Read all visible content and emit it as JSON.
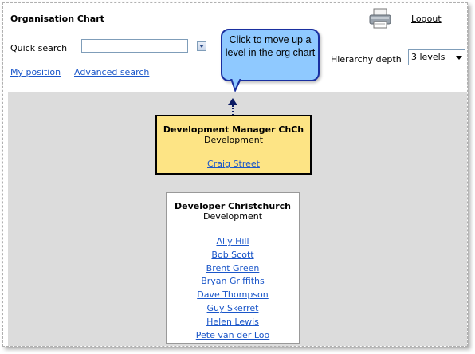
{
  "header": {
    "title": "Organisation Chart",
    "logout_label": "Logout",
    "print_icon": "printer-icon"
  },
  "search": {
    "quick_search_label": "Quick search",
    "quick_search_value": "",
    "my_position_label": "My position",
    "advanced_search_label": "Advanced search"
  },
  "hierarchy": {
    "label": "Hierarchy depth",
    "selected": "3 levels"
  },
  "callout": {
    "text": "Click to move up a level in the org chart"
  },
  "colors": {
    "manager_fill": "#fde485",
    "chart_background": "#dcdcdc",
    "callout_fill": "#8fc9ff",
    "link": "#1a56c9"
  },
  "org": {
    "manager": {
      "title": "Development Manager ChCh",
      "department": "Development",
      "people": [
        "Craig Street"
      ]
    },
    "report": {
      "title": "Developer Christchurch",
      "department": "Development",
      "people": [
        "Ally Hill",
        "Bob Scott",
        "Brent Green",
        "Bryan Griffiths",
        "Dave Thompson",
        "Guy Skerret",
        "Helen Lewis",
        "Pete van der Loo"
      ]
    }
  }
}
